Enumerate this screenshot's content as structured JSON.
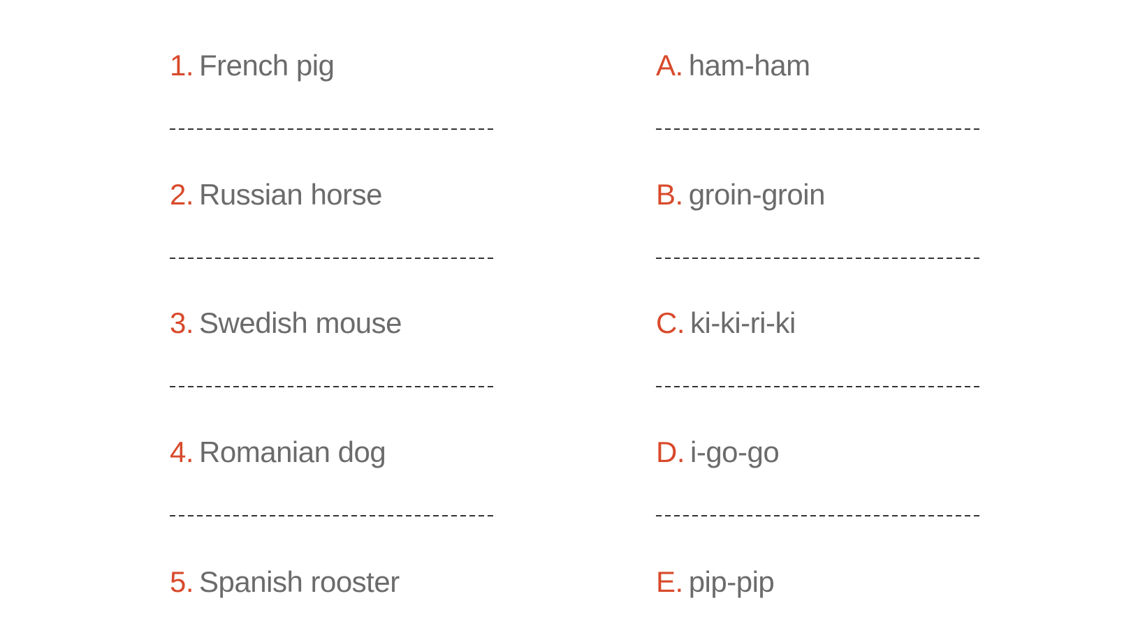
{
  "worksheet": {
    "left_items": [
      {
        "marker": "1.",
        "text": "French pig"
      },
      {
        "marker": "2.",
        "text": "Russian horse"
      },
      {
        "marker": "3.",
        "text": "Swedish mouse"
      },
      {
        "marker": "4.",
        "text": "Romanian dog"
      },
      {
        "marker": "5.",
        "text": "Spanish rooster"
      }
    ],
    "right_items": [
      {
        "marker": "A.",
        "text": "ham-ham"
      },
      {
        "marker": "B.",
        "text": "groin-groin"
      },
      {
        "marker": "C.",
        "text": "ki-ki-ri-ki"
      },
      {
        "marker": "D.",
        "text": "i-go-go"
      },
      {
        "marker": "E.",
        "text": "pip-pip"
      }
    ],
    "colors": {
      "marker": "#d84a2b",
      "text": "#6b6b6b",
      "answer_line": "#333333"
    }
  }
}
